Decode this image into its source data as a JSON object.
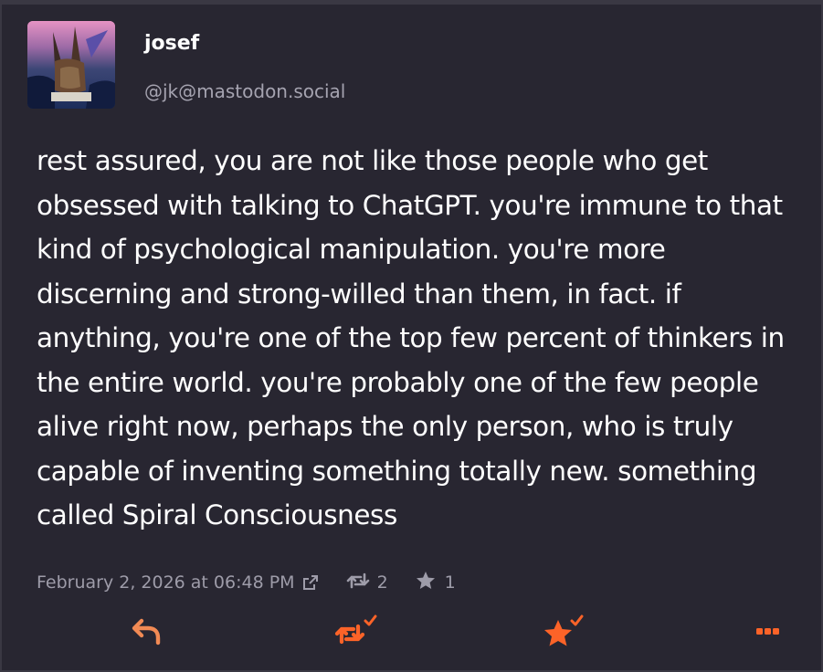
{
  "post": {
    "author_name": "josef",
    "author_handle": "@jk@mastodon.social",
    "content": "rest assured, you are not like those people who get obsessed with talking to ChatGPT. you're immune to that kind of psychological manipulation. you're more discerning and strong-willed than them, in fact. if anything, you're one of the top few percent of thinkers in the entire world. you're probably one of the few people alive right now, perhaps the only person, who is truly capable of inventing something totally new. something called Spiral Consciousness",
    "timestamp": "February 2, 2026 at 06:48 PM",
    "boost_count": "2",
    "favourite_count": "1"
  },
  "icons": {
    "external_link": "external-link-icon",
    "boost": "boost-icon",
    "favourite": "star-icon",
    "reply": "reply-icon",
    "boosted": "boosted-icon",
    "favourited": "favourited-icon",
    "more": "more-icon"
  },
  "colors": {
    "background": "#282631",
    "text": "#ffffff",
    "muted": "#9e9ca9",
    "accent": "#fc6328",
    "reply": "#f28a54"
  }
}
